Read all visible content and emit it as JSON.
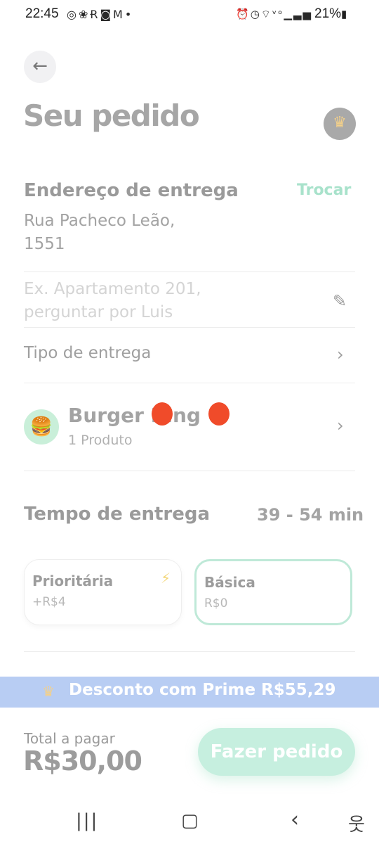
{
  "status_bar": {
    "time": "22:45",
    "battery": "21%",
    "notification_icons": [
      "whatsapp-icon",
      "ribbon-icon",
      "r-app-icon",
      "instagram-icon",
      "gmail-icon",
      "dot-icon"
    ],
    "system_icons": [
      "alarm-icon",
      "clock-icon",
      "wifi-icon",
      "volte-icon",
      "signal-icon",
      "battery-icon"
    ]
  },
  "header": {
    "title": "Seu pedido"
  },
  "address": {
    "title": "Endereço de entrega",
    "change_label": "Trocar",
    "street": "Rua Pacheco Leão,",
    "number": "1551",
    "complement_placeholder": "Ex. Apartamento 201, perguntar por Luis"
  },
  "delivery_type": {
    "label": "Tipo de entrega"
  },
  "store": {
    "name": "Burger King",
    "products": "1 Produto"
  },
  "delivery_time": {
    "title": "Tempo de entrega",
    "range": "39 - 54 min",
    "options": [
      {
        "name": "Prioritária",
        "price": "+R$4",
        "selected": false
      },
      {
        "name": "Básica",
        "price": "R$0",
        "selected": true
      }
    ]
  },
  "prime_banner": {
    "text": "Desconto com Prime R$55,29"
  },
  "footer": {
    "total_label": "Total a pagar",
    "total_value": "R$30,00",
    "order_button": "Fazer pedido"
  },
  "colors": {
    "accent_green": "#a8e2cb",
    "prime_blue": "#b8cdf3",
    "touch_marker": "#f04b2a"
  }
}
